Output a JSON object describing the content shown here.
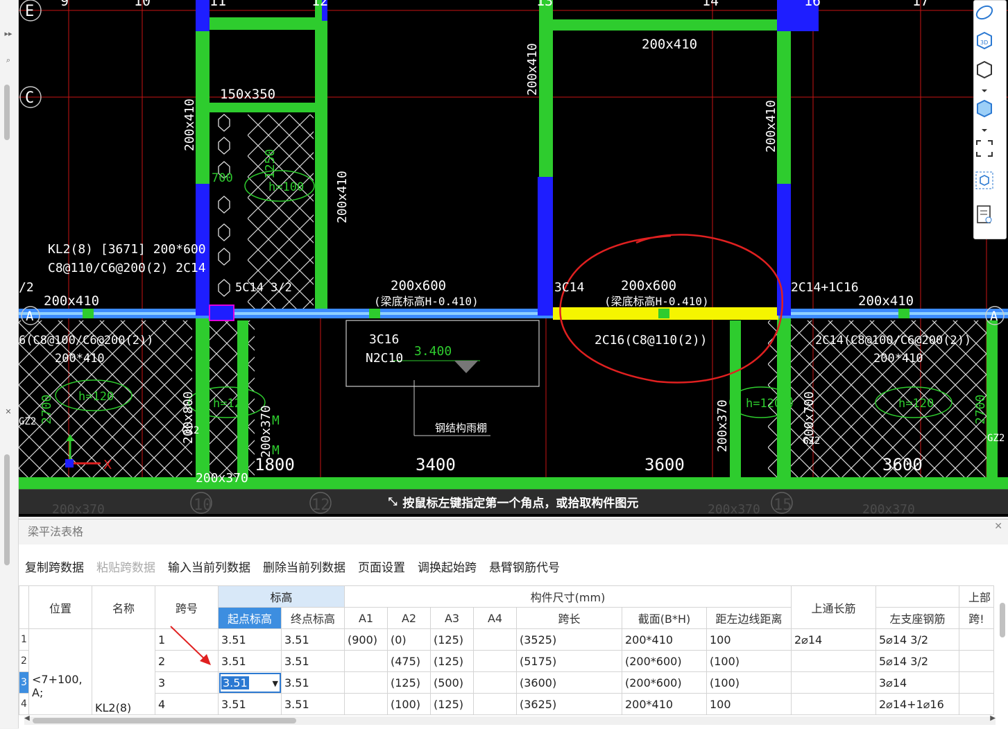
{
  "cad": {
    "axis_top": [
      "E",
      "9",
      "10",
      "11",
      "12",
      "13",
      "14",
      "16",
      "17"
    ],
    "axis_left": [
      "E",
      "C",
      "A"
    ],
    "axis_bottom": [
      "10",
      "12",
      "15"
    ],
    "axis_right": "A",
    "axis_left_partial": "/2",
    "beam_kl2_label": "KL2(8) [3671] 200*600",
    "beam_kl2_stirrup": "C8@110/C6@200(2) 2C14",
    "labels": {
      "b200x410_top": "200x410",
      "b150x350": "150x350",
      "b200x410_v1": "200x410",
      "b200x410_v2": "200x410",
      "b200x410_v3": "200x410",
      "b200x410_v4": "200x410",
      "dim_1250": "1250",
      "dim_h100": "h=100",
      "dim_700": "700",
      "b200x410_left": "200x410",
      "bar_5c14": "5C14 3/2",
      "b200x600_a": "200x600",
      "elev_a": "(梁底标高H-0.410)",
      "bar_3c14": "3C14",
      "b200x600_b": "200x600",
      "elev_b": "(梁底标高H-0.410)",
      "bar_2c14_1c16": "2C14+1C16",
      "b200x410_right": "200x410",
      "stir_left": "6(C8@100/C6@200(2))",
      "b200x410_l2": "200*410",
      "box_3c16": "3C16",
      "box_n2c10": "N2C10",
      "level_3400": "3.400",
      "bar_2c16": "2C16(C8@110(2))",
      "stir_right": "2C14(C8@100/C6@200(2))",
      "b200x410_r2": "200*410",
      "slab_h120_a": "h=120",
      "slab_h120_b": "h=120",
      "slab_h120_c": "h=120",
      "slab_h12": "h=12",
      "dim_2700_l": "2700",
      "dim_2700_r": "2700",
      "b200x370_a": "200x370",
      "b200x370_b": "200x370",
      "b200x370_c": "200x370",
      "b200x370_d": "200x370",
      "b200x370_e": "200x370",
      "b200x700": "200x700",
      "b200x800": "200x800",
      "span_1800": "1800",
      "span_3400": "3400",
      "span_3600_a": "3600",
      "span_3600_b": "3600",
      "steel_stair": "钢结构雨棚",
      "gz2_a": "GZ2",
      "gz2_b": "GZ2",
      "gz2_c": "GZ2",
      "gz2_d": "GZ2",
      "mark_m1": "M",
      "mark_m2": "M",
      "ucs_x": "X"
    },
    "prompt": "按鼠标左键指定第一个角点，或拾取构件图元"
  },
  "panel": {
    "title": "梁平法表格",
    "menu": [
      {
        "label": "复制跨数据",
        "enabled": true
      },
      {
        "label": "粘贴跨数据",
        "enabled": false
      },
      {
        "label": "输入当前列数据",
        "enabled": true
      },
      {
        "label": "删除当前列数据",
        "enabled": true
      },
      {
        "label": "页面设置",
        "enabled": true
      },
      {
        "label": "调换起始跨",
        "enabled": true
      },
      {
        "label": "悬臂钢筋代号",
        "enabled": true
      }
    ],
    "headers": {
      "position": "位置",
      "name": "名称",
      "span_no": "跨号",
      "elevation": "标高",
      "start_elev": "起点标高",
      "end_elev": "终点标高",
      "dims": "构件尺寸(mm)",
      "a1": "A1",
      "a2": "A2",
      "a3": "A3",
      "a4": "A4",
      "span_len": "跨长",
      "section": "截面(B*H)",
      "dist_left": "距左边线距离",
      "top_through": "上通长筋",
      "left_support": "左支座钢筋",
      "upper": "上部",
      "span_cut": "跨!"
    },
    "position_value": "<7+100, A;",
    "name_value": "KL2(8)",
    "rows": [
      {
        "n": "1",
        "span": "1",
        "start": "3.51",
        "end": "3.51",
        "a1": "(900)",
        "a2": "(0)",
        "a3": "(125)",
        "a4": "",
        "len": "(3525)",
        "sec": "200*410",
        "dist": "100",
        "top": "2⌀14",
        "left": "5⌀14 3/2"
      },
      {
        "n": "2",
        "span": "2",
        "start": "3.51",
        "end": "3.51",
        "a1": "",
        "a2": "(475)",
        "a3": "(125)",
        "a4": "",
        "len": "(5175)",
        "sec": "(200*600)",
        "dist": "(100)",
        "top": "",
        "left": "5⌀14 3/2"
      },
      {
        "n": "3",
        "span": "3",
        "start": "3.51",
        "end": "3.51",
        "a1": "",
        "a2": "(125)",
        "a3": "(500)",
        "a4": "",
        "len": "(3600)",
        "sec": "(200*600)",
        "dist": "(100)",
        "top": "",
        "left": "3⌀14"
      },
      {
        "n": "4",
        "span": "4",
        "start": "3.51",
        "end": "3.51",
        "a1": "",
        "a2": "(100)",
        "a3": "(125)",
        "a4": "",
        "len": "(3625)",
        "sec": "200*410",
        "dist": "100",
        "top": "",
        "left": "2⌀14+1⌀16"
      }
    ]
  },
  "colors": {
    "beam_green": "#2ecc2e",
    "column_blue": "#1e1eff",
    "axis_red": "#d11",
    "highlight_yellow": "#f5f500",
    "annotation_red": "#e02020",
    "selection_blue": "#2b79d2"
  }
}
